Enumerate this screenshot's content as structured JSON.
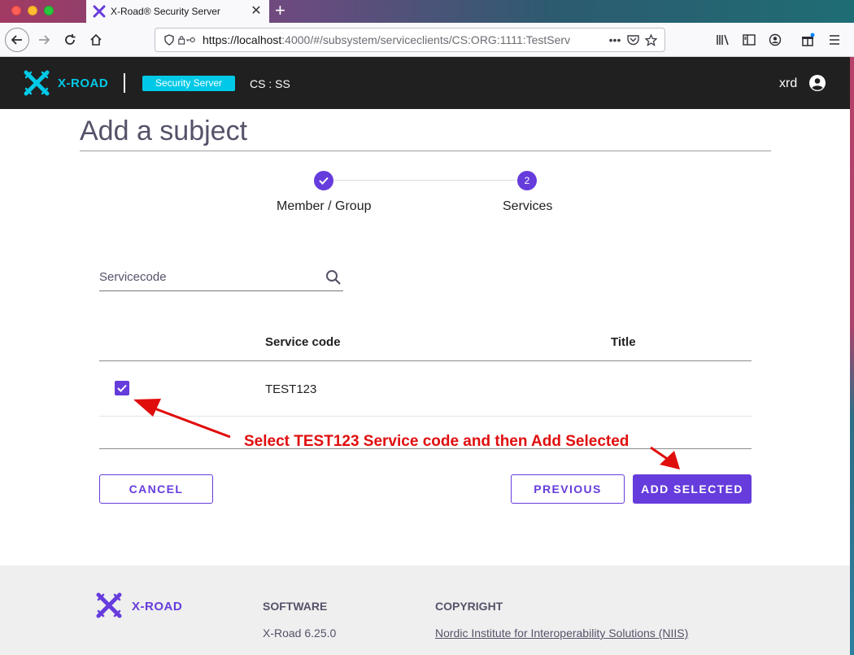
{
  "browser": {
    "tab_title": "X-Road® Security Server",
    "tab_close": "✕",
    "new_tab": "+",
    "url_host": "https://localhost",
    "url_rest": ":4000/#/subsystem/serviceclients/CS:ORG:1111:TestServ"
  },
  "header": {
    "logo_text": "X-ROAD",
    "badge": "Security Server",
    "cs": "CS : SS",
    "username": "xrd"
  },
  "page": {
    "title": "Add a subject"
  },
  "stepper": {
    "step1_label": "Member / Group",
    "step2_number": "2",
    "step2_label": "Services"
  },
  "search": {
    "placeholder": "Servicecode"
  },
  "table": {
    "columns": [
      "Service code",
      "Title"
    ],
    "rows": [
      {
        "checked": true,
        "service_code": "TEST123",
        "title": ""
      }
    ]
  },
  "buttons": {
    "cancel": "CANCEL",
    "previous": "PREVIOUS",
    "add_selected": "ADD SELECTED"
  },
  "annotation": {
    "text": "Select TEST123 Service code and then Add Selected"
  },
  "footer": {
    "logo_text": "X-ROAD",
    "software_heading": "SOFTWARE",
    "version": "X-Road 6.25.0",
    "copyright_heading": "COPYRIGHT",
    "copyright_link": "Nordic Institute for Interoperability Solutions (NIIS)"
  },
  "colors": {
    "primary": "#663cdc",
    "brand_cyan": "#00c9e7",
    "appbar": "#202020",
    "annotation": "#e00d0d"
  }
}
